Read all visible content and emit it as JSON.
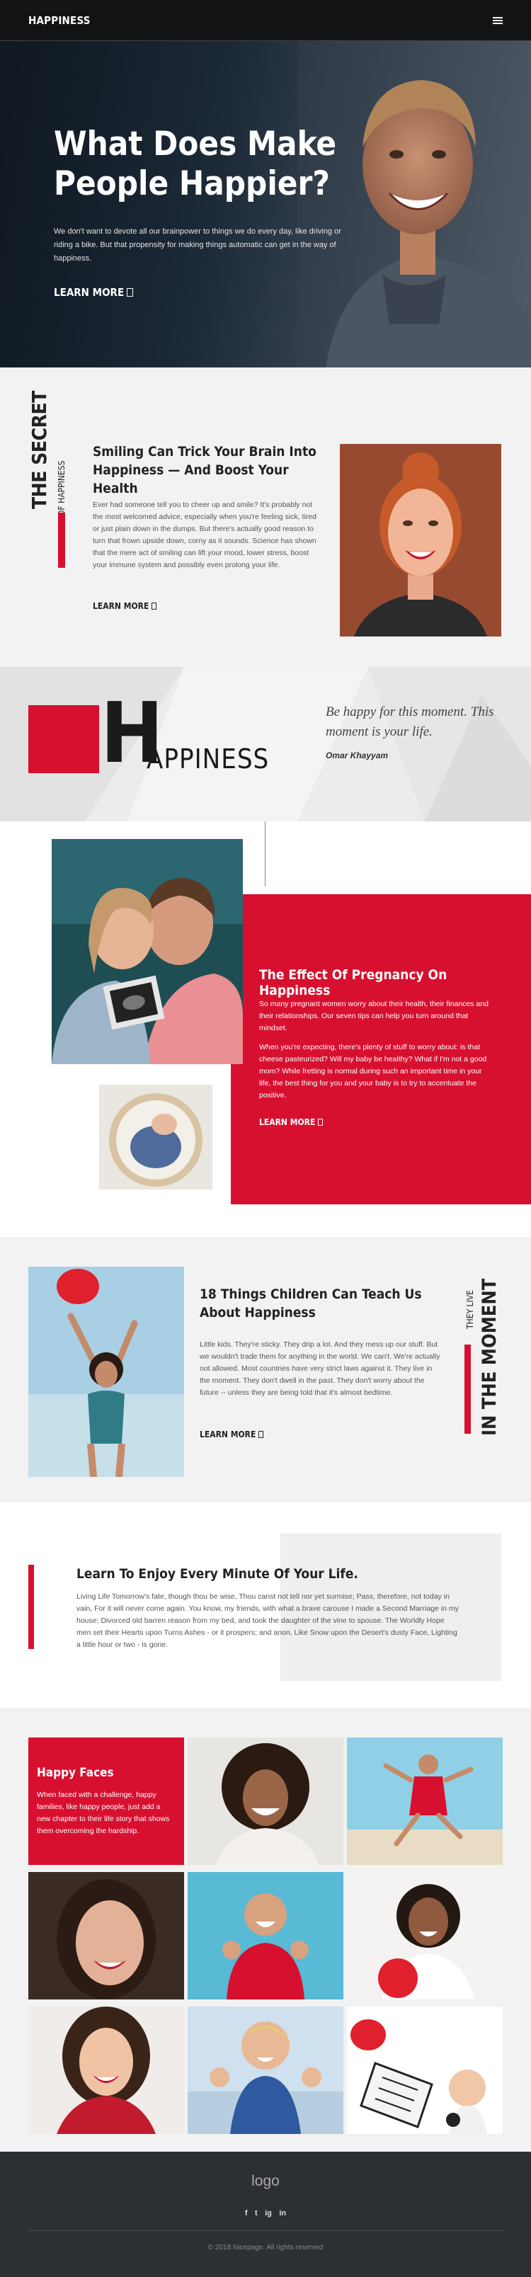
{
  "header": {
    "brand": "HAPPINESS",
    "menu_icon": "hamburger-icon"
  },
  "hero": {
    "title": "What Does Make People Happier?",
    "text": "We don't want to devote all our brainpower to things we do every day, like driving or riding a bike. But that propensity for making things automatic can get in the way of happiness.",
    "link": "LEARN MORE"
  },
  "secret": {
    "vertical_big": "THE SECRET",
    "vertical_small": "OF HAPPINESS",
    "title": "Smiling Can Trick Your Brain Into Happiness — And Boost Your Health",
    "text": "Ever had someone tell you to cheer up and smile? It's probably not the most welcomed advice, especially when you're feeling sick, tired or just plain down in the dumps. But there's actually good reason to turn that frown upside down, corny as it sounds. Science has shown that the mere act of smiling can lift your mood, lower stress, boost your immune system and possibly even prolong your life.",
    "link": "LEARN MORE"
  },
  "brand_strip": {
    "big_letter": "H",
    "word": "APPINESS",
    "quote": "Be happy for this moment. This moment is your life.",
    "author": "Omar Khayyam"
  },
  "pregnancy": {
    "title": "The Effect Of Pregnancy On Happiness",
    "text1": "So many pregnant women worry about their health, their finances and their relationships. Our seven tips can help you turn around that mindset.",
    "text2": "When you're expecting, there's plenty of stuff to worry about: is that cheese pasteurized? Will my baby be healthy? What if I'm not a good mom? While fretting is normal during such an important time in your life, the best thing for you and your baby is to try to accentuate the positive.",
    "link": "LEARN MORE"
  },
  "children": {
    "title": "18 Things Children Can Teach Us About Happiness",
    "text": "Little kids. They're sticky. They drip a lot. And they mess up our stuff. But we wouldn't trade them for anything in the world. We can't. We're actually not allowed. Most countries have very strict laws against it. They live in the moment. They don't dwell in the past. They don't worry about the future -- unless they are being told that it's almost bedtime.",
    "link": "LEARN MORE",
    "vertical_small": "THEY LIVE",
    "vertical_big": "IN THE MOMENT"
  },
  "learn": {
    "title": "Learn To Enjoy Every Minute Of Your Life.",
    "text": "Living Life Tomorrow's fate, though thou be wise, Thou canst not tell nor yet surmise; Pass, therefore, not today in vain, For it will never come again. You know, my friends, with what a brave carouse I made a Second Marriage in my house; Divorced old barren reason from my bed, and took the daughter of the vine to spouse.  The Worldly Hope men set their Hearts upon Turns Ashes - or it prospers; and anon, Like Snow upon the Desert's dusty Face, Lighting a little hour or two - is gone."
  },
  "faces": {
    "title": "Happy Faces",
    "text": "When faced with a challenge, happy families, like happy people, just add a new chapter to their life story that shows them overcoming the hardship."
  },
  "footer": {
    "logo": "logo",
    "social": [
      "f",
      "t",
      "ig",
      "in"
    ],
    "social_icons": [
      "facebook-icon",
      "twitter-icon",
      "instagram-icon",
      "linkedin-icon"
    ],
    "copyright": "© 2018 Nicepage. All rights reserved"
  },
  "colors": {
    "accent": "#d8102f",
    "dark": "#121314",
    "light": "#f2f2f2",
    "footer": "#2c2f33"
  }
}
